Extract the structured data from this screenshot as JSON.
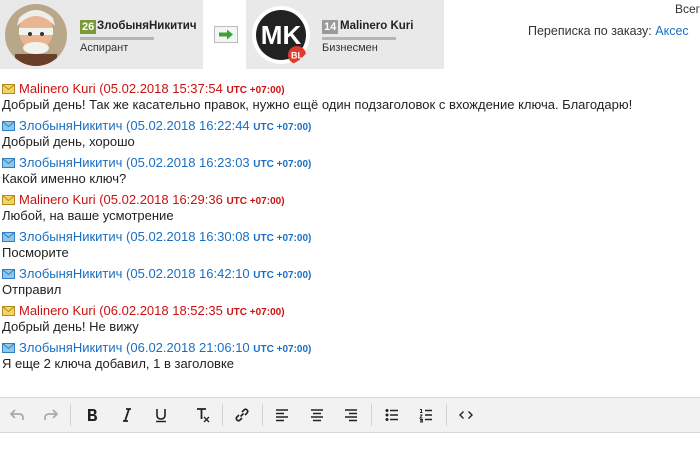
{
  "header": {
    "left_user": {
      "level": "26",
      "name": "ЗлобыняНикитич",
      "rank": "Аспирант"
    },
    "right_user": {
      "level": "14",
      "name": "Malinero Kuri",
      "rank": "Бизнесмен",
      "avatar_letters": "MK",
      "avatar_badge": "BL"
    },
    "top_right_text": "Всег",
    "correspondence_label": "Переписка по заказу:",
    "order_link": "Аксес"
  },
  "colors": {
    "red_author": "#cc1111",
    "blue_author": "#1a6fc4",
    "level_green": "#7a9a3a",
    "badge_red": "#e03a2a"
  },
  "messages": [
    {
      "author": "Malinero Kuri",
      "date": "(05.02.2018 15:37:54",
      "utc": "UTC +07:00)",
      "text": "Добрый день! Так же касательно правок, нужно ещё один подзаголовок с вхождение ключа. Благодарю!"
    },
    {
      "author": "ЗлобыняНикитич",
      "date": "(05.02.2018 16:22:44",
      "utc": "UTC +07:00)",
      "text": "Добрый день, хорошо"
    },
    {
      "author": "ЗлобыняНикитич",
      "date": "(05.02.2018 16:23:03",
      "utc": "UTC +07:00)",
      "text": "Какой именно ключ?"
    },
    {
      "author": "Malinero Kuri",
      "date": "(05.02.2018 16:29:36",
      "utc": "UTC +07:00)",
      "text": "Любой, на ваше усмотрение"
    },
    {
      "author": "ЗлобыняНикитич",
      "date": "(05.02.2018 16:30:08",
      "utc": "UTC +07:00)",
      "text": "Посморите"
    },
    {
      "author": "ЗлобыняНикитич",
      "date": "(05.02.2018 16:42:10",
      "utc": "UTC +07:00)",
      "text": "Отправил"
    },
    {
      "author": "Malinero Kuri",
      "date": "(06.02.2018 18:52:35",
      "utc": "UTC +07:00)",
      "text": "Добрый день! Не вижу"
    },
    {
      "author": "ЗлобыняНикитич",
      "date": "(06.02.2018 21:06:10",
      "utc": "UTC +07:00)",
      "text": "Я еще 2 ключа добавил, 1 в заголовке"
    }
  ],
  "toolbar_icons": [
    "undo-icon",
    "redo-icon",
    "bold-icon",
    "italic-icon",
    "underline-icon",
    "clear-format-icon",
    "link-icon",
    "align-left-icon",
    "align-center-icon",
    "align-right-icon",
    "bullet-list-icon",
    "numbered-list-icon",
    "source-code-icon"
  ]
}
